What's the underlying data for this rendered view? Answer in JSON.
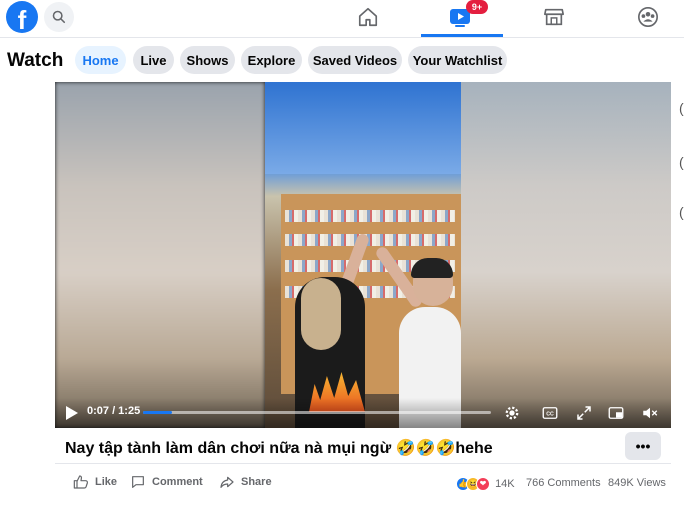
{
  "topbar": {
    "logo": "f",
    "search_icon": "search-icon",
    "nav": [
      "home-icon",
      "watch-icon",
      "marketplace-icon",
      "groups-icon"
    ],
    "watch_badge": "9+",
    "accent": "#1877f2",
    "badge_color": "#e41e3f"
  },
  "watch": {
    "title": "Watch",
    "tabs": [
      {
        "label": "Home",
        "active": true
      },
      {
        "label": "Live"
      },
      {
        "label": "Shows"
      },
      {
        "label": "Explore"
      },
      {
        "label": "Saved Videos"
      },
      {
        "label": "Your Watchlist"
      }
    ]
  },
  "video": {
    "time": "0:07 / 1:25",
    "progress": 0.082,
    "title": "Nay tập tành làm dân chơi nữa nà mụi ngừ 🤣🤣🤣hehe",
    "controls": [
      "settings-icon",
      "captions-icon",
      "fullscreen-icon",
      "miniplayer-icon",
      "volume-icon"
    ]
  },
  "actions": {
    "like": "Like",
    "comment": "Comment",
    "share": "Share",
    "reactions_count": "14K",
    "comments": "766 Comments",
    "views": "849K Views"
  }
}
